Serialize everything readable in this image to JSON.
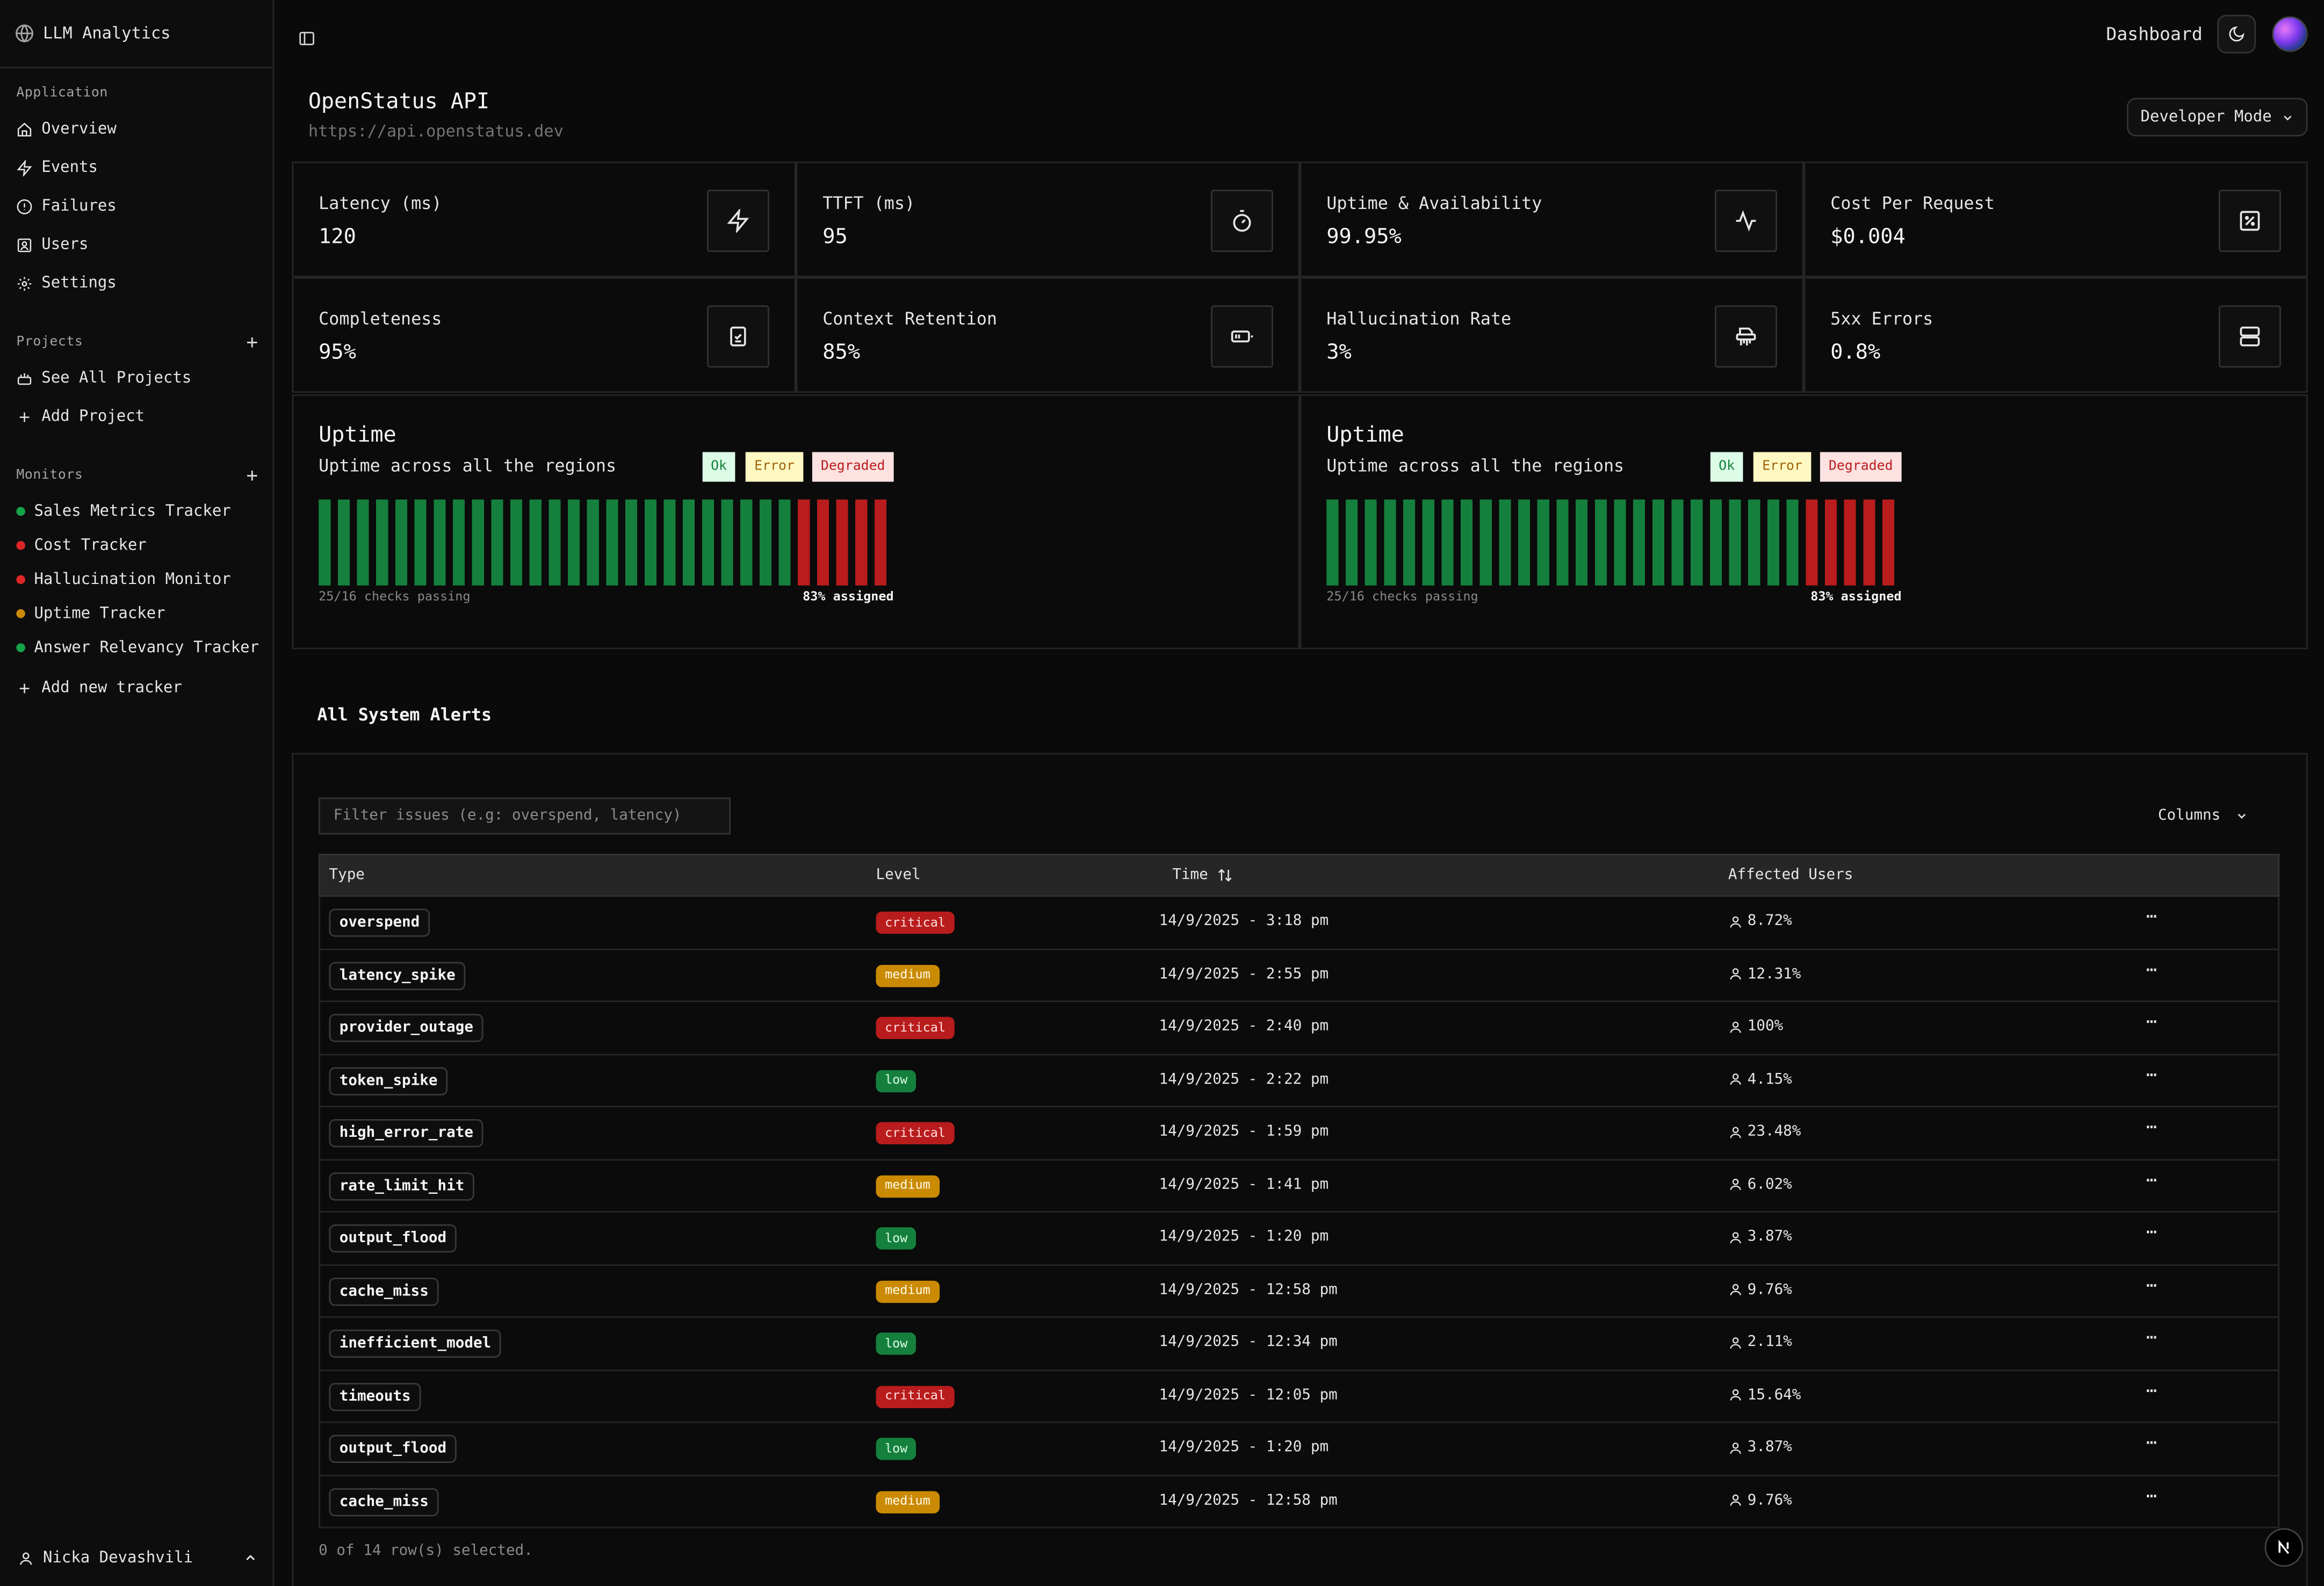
{
  "app": {
    "title": "LLM Analytics"
  },
  "sidebar": {
    "application_label": "Application",
    "nav": [
      {
        "label": "Overview",
        "icon": "home-icon"
      },
      {
        "label": "Events",
        "icon": "zap-icon"
      },
      {
        "label": "Failures",
        "icon": "alert-circle-icon"
      },
      {
        "label": "Users",
        "icon": "user-square-icon"
      },
      {
        "label": "Settings",
        "icon": "gear-icon"
      }
    ],
    "projects_label": "Projects",
    "projects": [
      {
        "label": "See All Projects",
        "icon": "projects-icon"
      },
      {
        "label": "Add Project",
        "icon": "plus-icon"
      }
    ],
    "monitors_label": "Monitors",
    "monitors": [
      {
        "label": "Sales Metrics Tracker",
        "color": "#16a34a"
      },
      {
        "label": "Cost Tracker",
        "color": "#dc2626"
      },
      {
        "label": "Hallucination Monitor",
        "color": "#dc2626"
      },
      {
        "label": "Uptime Tracker",
        "color": "#ca8a04"
      },
      {
        "label": "Answer Relevancy Tracker",
        "color": "#16a34a"
      }
    ],
    "add_tracker": "Add new tracker",
    "user_name": "Nicka Devashvili"
  },
  "topbar": {
    "dashboard_label": "Dashboard"
  },
  "header": {
    "api_name": "OpenStatus API",
    "api_url": "https://api.openstatus.dev",
    "mode_label": "Developer Mode"
  },
  "metrics": [
    {
      "label": "Latency (ms)",
      "value": "120",
      "icon": "lightning-icon"
    },
    {
      "label": "TTFT (ms)",
      "value": "95",
      "icon": "stopwatch-icon"
    },
    {
      "label": "Uptime & Availability",
      "value": "99.95%",
      "icon": "activity-icon"
    },
    {
      "label": "Cost Per Request",
      "value": "$0.004",
      "icon": "percent-square-icon"
    },
    {
      "label": "Completeness",
      "value": "95%",
      "icon": "clipboard-check-icon"
    },
    {
      "label": "Context Retention",
      "value": "85%",
      "icon": "battery-icon"
    },
    {
      "label": "Hallucination Rate",
      "value": "3%",
      "icon": "shredder-icon"
    },
    {
      "label": "5xx Errors",
      "value": "0.8%",
      "icon": "server-icon"
    }
  ],
  "uptime_panels": [
    {
      "title": "Uptime",
      "subtitle": "Uptime across all the regions",
      "legend": {
        "ok": "Ok",
        "error": "Error",
        "degraded": "Degraded"
      },
      "checks_text": "25/16 checks passing",
      "assigned_text": "83% assigned",
      "bars": {
        "ok": 25,
        "degraded": 5
      }
    },
    {
      "title": "Uptime",
      "subtitle": "Uptime across all the regions",
      "legend": {
        "ok": "Ok",
        "error": "Error",
        "degraded": "Degraded"
      },
      "checks_text": "25/16 checks passing",
      "assigned_text": "83% assigned",
      "bars": {
        "ok": 25,
        "degraded": 5
      }
    }
  ],
  "colors": {
    "ok_bar": "#15803d",
    "degraded_bar": "#b91c1c"
  },
  "alerts": {
    "title": "All System Alerts",
    "filter_placeholder": "Filter issues (e.g: overspend, latency)",
    "columns_label": "Columns",
    "headers": {
      "type": "Type",
      "level": "Level",
      "time": "Time",
      "affected": "Affected Users"
    },
    "rows": [
      {
        "type": "overspend",
        "level": "critical",
        "time": "14/9/2025 - 3:18 pm",
        "affected": "8.72%"
      },
      {
        "type": "latency_spike",
        "level": "medium",
        "time": "14/9/2025 - 2:55 pm",
        "affected": "12.31%"
      },
      {
        "type": "provider_outage",
        "level": "critical",
        "time": "14/9/2025 - 2:40 pm",
        "affected": "100%"
      },
      {
        "type": "token_spike",
        "level": "low",
        "time": "14/9/2025 - 2:22 pm",
        "affected": "4.15%"
      },
      {
        "type": "high_error_rate",
        "level": "critical",
        "time": "14/9/2025 - 1:59 pm",
        "affected": "23.48%"
      },
      {
        "type": "rate_limit_hit",
        "level": "medium",
        "time": "14/9/2025 - 1:41 pm",
        "affected": "6.02%"
      },
      {
        "type": "output_flood",
        "level": "low",
        "time": "14/9/2025 - 1:20 pm",
        "affected": "3.87%"
      },
      {
        "type": "cache_miss",
        "level": "medium",
        "time": "14/9/2025 - 12:58 pm",
        "affected": "9.76%"
      },
      {
        "type": "inefficient_model",
        "level": "low",
        "time": "14/9/2025 - 12:34 pm",
        "affected": "2.11%"
      },
      {
        "type": "timeouts",
        "level": "critical",
        "time": "14/9/2025 - 12:05 pm",
        "affected": "15.64%"
      },
      {
        "type": "output_flood",
        "level": "low",
        "time": "14/9/2025 - 1:20 pm",
        "affected": "3.87%"
      },
      {
        "type": "cache_miss",
        "level": "medium",
        "time": "14/9/2025 - 12:58 pm",
        "affected": "9.76%"
      }
    ],
    "selection_text": "0 of 14 row(s) selected."
  }
}
